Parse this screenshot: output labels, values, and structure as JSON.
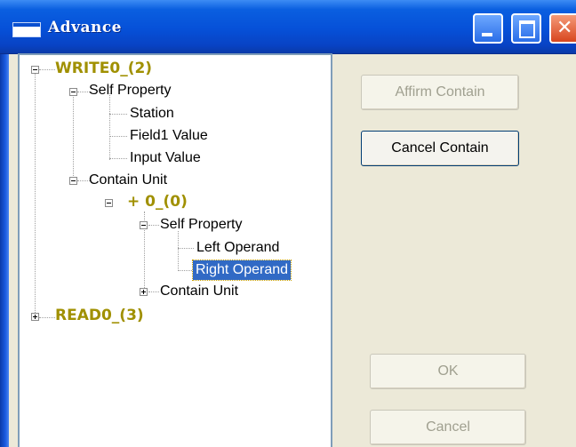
{
  "window": {
    "title": "Advance"
  },
  "tree": {
    "nodes": [
      {
        "label": "WRITE0_(2)"
      },
      {
        "label": "Self Property"
      },
      {
        "label": "Station"
      },
      {
        "label": "Field1 Value"
      },
      {
        "label": "Input Value"
      },
      {
        "label": "Contain Unit"
      },
      {
        "label": "+ 0_(0)"
      },
      {
        "label": "Self Property"
      },
      {
        "label": "Left Operand"
      },
      {
        "label": "Right Operand"
      },
      {
        "label": "Contain Unit"
      },
      {
        "label": "READ0_(3)"
      }
    ]
  },
  "buttons": {
    "affirm_contain": "Affirm Contain",
    "cancel_contain": "Cancel Contain",
    "ok": "OK",
    "cancel": "Cancel"
  },
  "colors": {
    "titlebar": "#0650d8",
    "root_node": "#a09000",
    "selection": "#316ac5"
  }
}
